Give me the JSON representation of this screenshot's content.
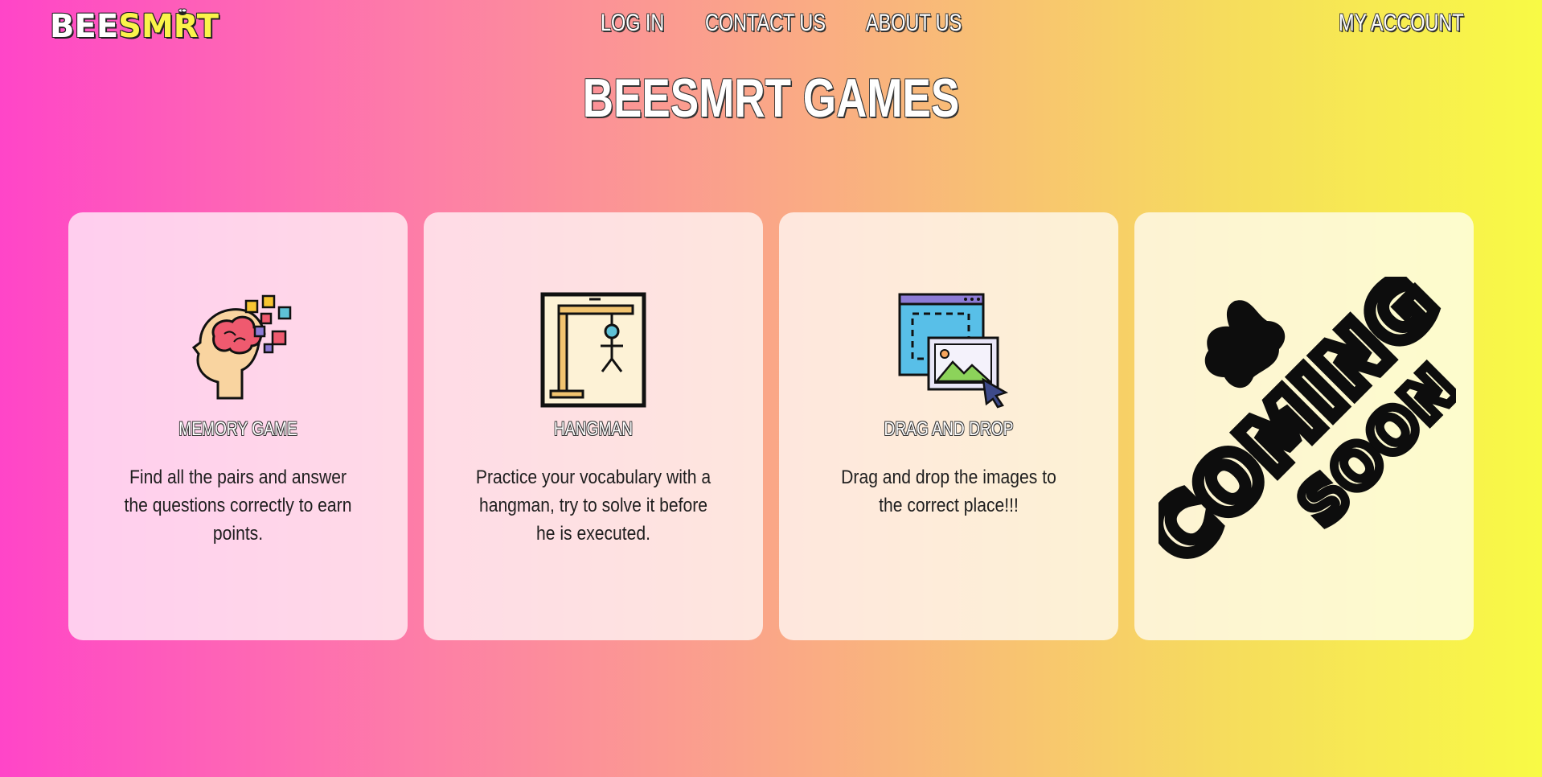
{
  "header": {
    "logo_part1": "BEE",
    "logo_part2": "SMRT",
    "nav": [
      "LOG IN",
      "CONTACT US",
      "ABOUT US"
    ],
    "account": "MY ACCOUNT"
  },
  "page": {
    "title": "BEESMRT GAMES"
  },
  "cards": [
    {
      "name": "MEMORY GAME",
      "desc": "Find all the pairs and answer the questions correctly to earn points.",
      "icon": "brain-head-icon"
    },
    {
      "name": "HANGMAN",
      "desc": "Practice your vocabulary with a hangman, try to solve it before he is executed.",
      "icon": "hangman-icon"
    },
    {
      "name": "DRAG AND DROP",
      "desc": "Drag and drop the images to the correct place!!!",
      "icon": "drag-drop-icon"
    },
    {
      "name": "",
      "desc": "",
      "icon": "coming-soon-badge",
      "badge_line1": "COMING",
      "badge_line2": "SOON"
    }
  ],
  "colors": {
    "gradient_left": "#ff45c8",
    "gradient_right": "#f8fa45",
    "logo_accent": "#fbf34a"
  }
}
